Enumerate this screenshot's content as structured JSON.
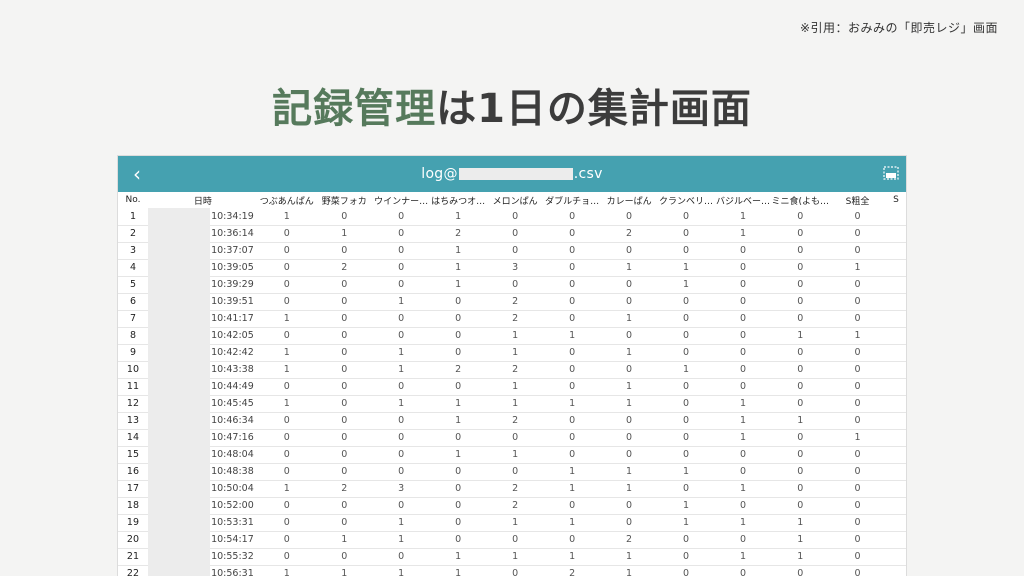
{
  "citation": "※引用：おみみの「即売レジ」画面",
  "slide_title": {
    "accent": "記録管理",
    "rest": "は1日の集計画面"
  },
  "appbar": {
    "file_prefix": "log@",
    "file_suffix": ".csv"
  },
  "colors": {
    "appbar": "#45a1b0",
    "title_accent": "#567a5c",
    "title_text": "#3c3c3c"
  },
  "icons": {
    "back": "chevron-left-icon",
    "export": "export-icon"
  },
  "table": {
    "headers": [
      "No.",
      "日時",
      "つぶあんぱん",
      "野菜フォカ",
      "ウインナー…",
      "はちみつオ…",
      "メロンぱん",
      "ダブルチョ…",
      "カレーぱん",
      "クランベリ…",
      "バジルベー…",
      "ミニ食(よも…",
      "S粗全",
      "S"
    ],
    "rows": [
      {
        "no": "1",
        "time": "10:34:19",
        "v": [
          "1",
          "0",
          "0",
          "1",
          "0",
          "0",
          "0",
          "0",
          "1",
          "0",
          "0"
        ]
      },
      {
        "no": "2",
        "time": "10:36:14",
        "v": [
          "0",
          "1",
          "0",
          "2",
          "0",
          "0",
          "2",
          "0",
          "1",
          "0",
          "0"
        ]
      },
      {
        "no": "3",
        "time": "10:37:07",
        "v": [
          "0",
          "0",
          "0",
          "1",
          "0",
          "0",
          "0",
          "0",
          "0",
          "0",
          "0"
        ]
      },
      {
        "no": "4",
        "time": "10:39:05",
        "v": [
          "0",
          "2",
          "0",
          "1",
          "3",
          "0",
          "1",
          "1",
          "0",
          "0",
          "1"
        ]
      },
      {
        "no": "5",
        "time": "10:39:29",
        "v": [
          "0",
          "0",
          "0",
          "1",
          "0",
          "0",
          "0",
          "1",
          "0",
          "0",
          "0"
        ]
      },
      {
        "no": "6",
        "time": "10:39:51",
        "v": [
          "0",
          "0",
          "1",
          "0",
          "2",
          "0",
          "0",
          "0",
          "0",
          "0",
          "0"
        ]
      },
      {
        "no": "7",
        "time": "10:41:17",
        "v": [
          "1",
          "0",
          "0",
          "0",
          "2",
          "0",
          "1",
          "0",
          "0",
          "0",
          "0"
        ]
      },
      {
        "no": "8",
        "time": "10:42:05",
        "v": [
          "0",
          "0",
          "0",
          "0",
          "1",
          "1",
          "0",
          "0",
          "0",
          "1",
          "1"
        ]
      },
      {
        "no": "9",
        "time": "10:42:42",
        "v": [
          "1",
          "0",
          "1",
          "0",
          "1",
          "0",
          "1",
          "0",
          "0",
          "0",
          "0"
        ]
      },
      {
        "no": "10",
        "time": "10:43:38",
        "v": [
          "1",
          "0",
          "1",
          "2",
          "2",
          "0",
          "0",
          "1",
          "0",
          "0",
          "0"
        ]
      },
      {
        "no": "11",
        "time": "10:44:49",
        "v": [
          "0",
          "0",
          "0",
          "0",
          "1",
          "0",
          "1",
          "0",
          "0",
          "0",
          "0"
        ]
      },
      {
        "no": "12",
        "time": "10:45:45",
        "v": [
          "1",
          "0",
          "1",
          "1",
          "1",
          "1",
          "1",
          "0",
          "1",
          "0",
          "0"
        ]
      },
      {
        "no": "13",
        "time": "10:46:34",
        "v": [
          "0",
          "0",
          "0",
          "1",
          "2",
          "0",
          "0",
          "0",
          "1",
          "1",
          "0"
        ]
      },
      {
        "no": "14",
        "time": "10:47:16",
        "v": [
          "0",
          "0",
          "0",
          "0",
          "0",
          "0",
          "0",
          "0",
          "1",
          "0",
          "1"
        ]
      },
      {
        "no": "15",
        "time": "10:48:04",
        "v": [
          "0",
          "0",
          "0",
          "1",
          "1",
          "0",
          "0",
          "0",
          "0",
          "0",
          "0"
        ]
      },
      {
        "no": "16",
        "time": "10:48:38",
        "v": [
          "0",
          "0",
          "0",
          "0",
          "0",
          "1",
          "1",
          "1",
          "0",
          "0",
          "0"
        ]
      },
      {
        "no": "17",
        "time": "10:50:04",
        "v": [
          "1",
          "2",
          "3",
          "0",
          "2",
          "1",
          "1",
          "0",
          "1",
          "0",
          "0"
        ]
      },
      {
        "no": "18",
        "time": "10:52:00",
        "v": [
          "0",
          "0",
          "0",
          "0",
          "2",
          "0",
          "0",
          "1",
          "0",
          "0",
          "0"
        ]
      },
      {
        "no": "19",
        "time": "10:53:31",
        "v": [
          "0",
          "0",
          "1",
          "0",
          "1",
          "1",
          "0",
          "1",
          "1",
          "1",
          "0"
        ]
      },
      {
        "no": "20",
        "time": "10:54:17",
        "v": [
          "0",
          "1",
          "1",
          "0",
          "0",
          "0",
          "2",
          "0",
          "0",
          "1",
          "0"
        ]
      },
      {
        "no": "21",
        "time": "10:55:32",
        "v": [
          "0",
          "0",
          "0",
          "1",
          "1",
          "1",
          "1",
          "0",
          "1",
          "1",
          "0"
        ]
      },
      {
        "no": "22",
        "time": "10:56:31",
        "v": [
          "1",
          "1",
          "1",
          "1",
          "0",
          "2",
          "1",
          "0",
          "0",
          "0",
          "0"
        ]
      }
    ]
  }
}
